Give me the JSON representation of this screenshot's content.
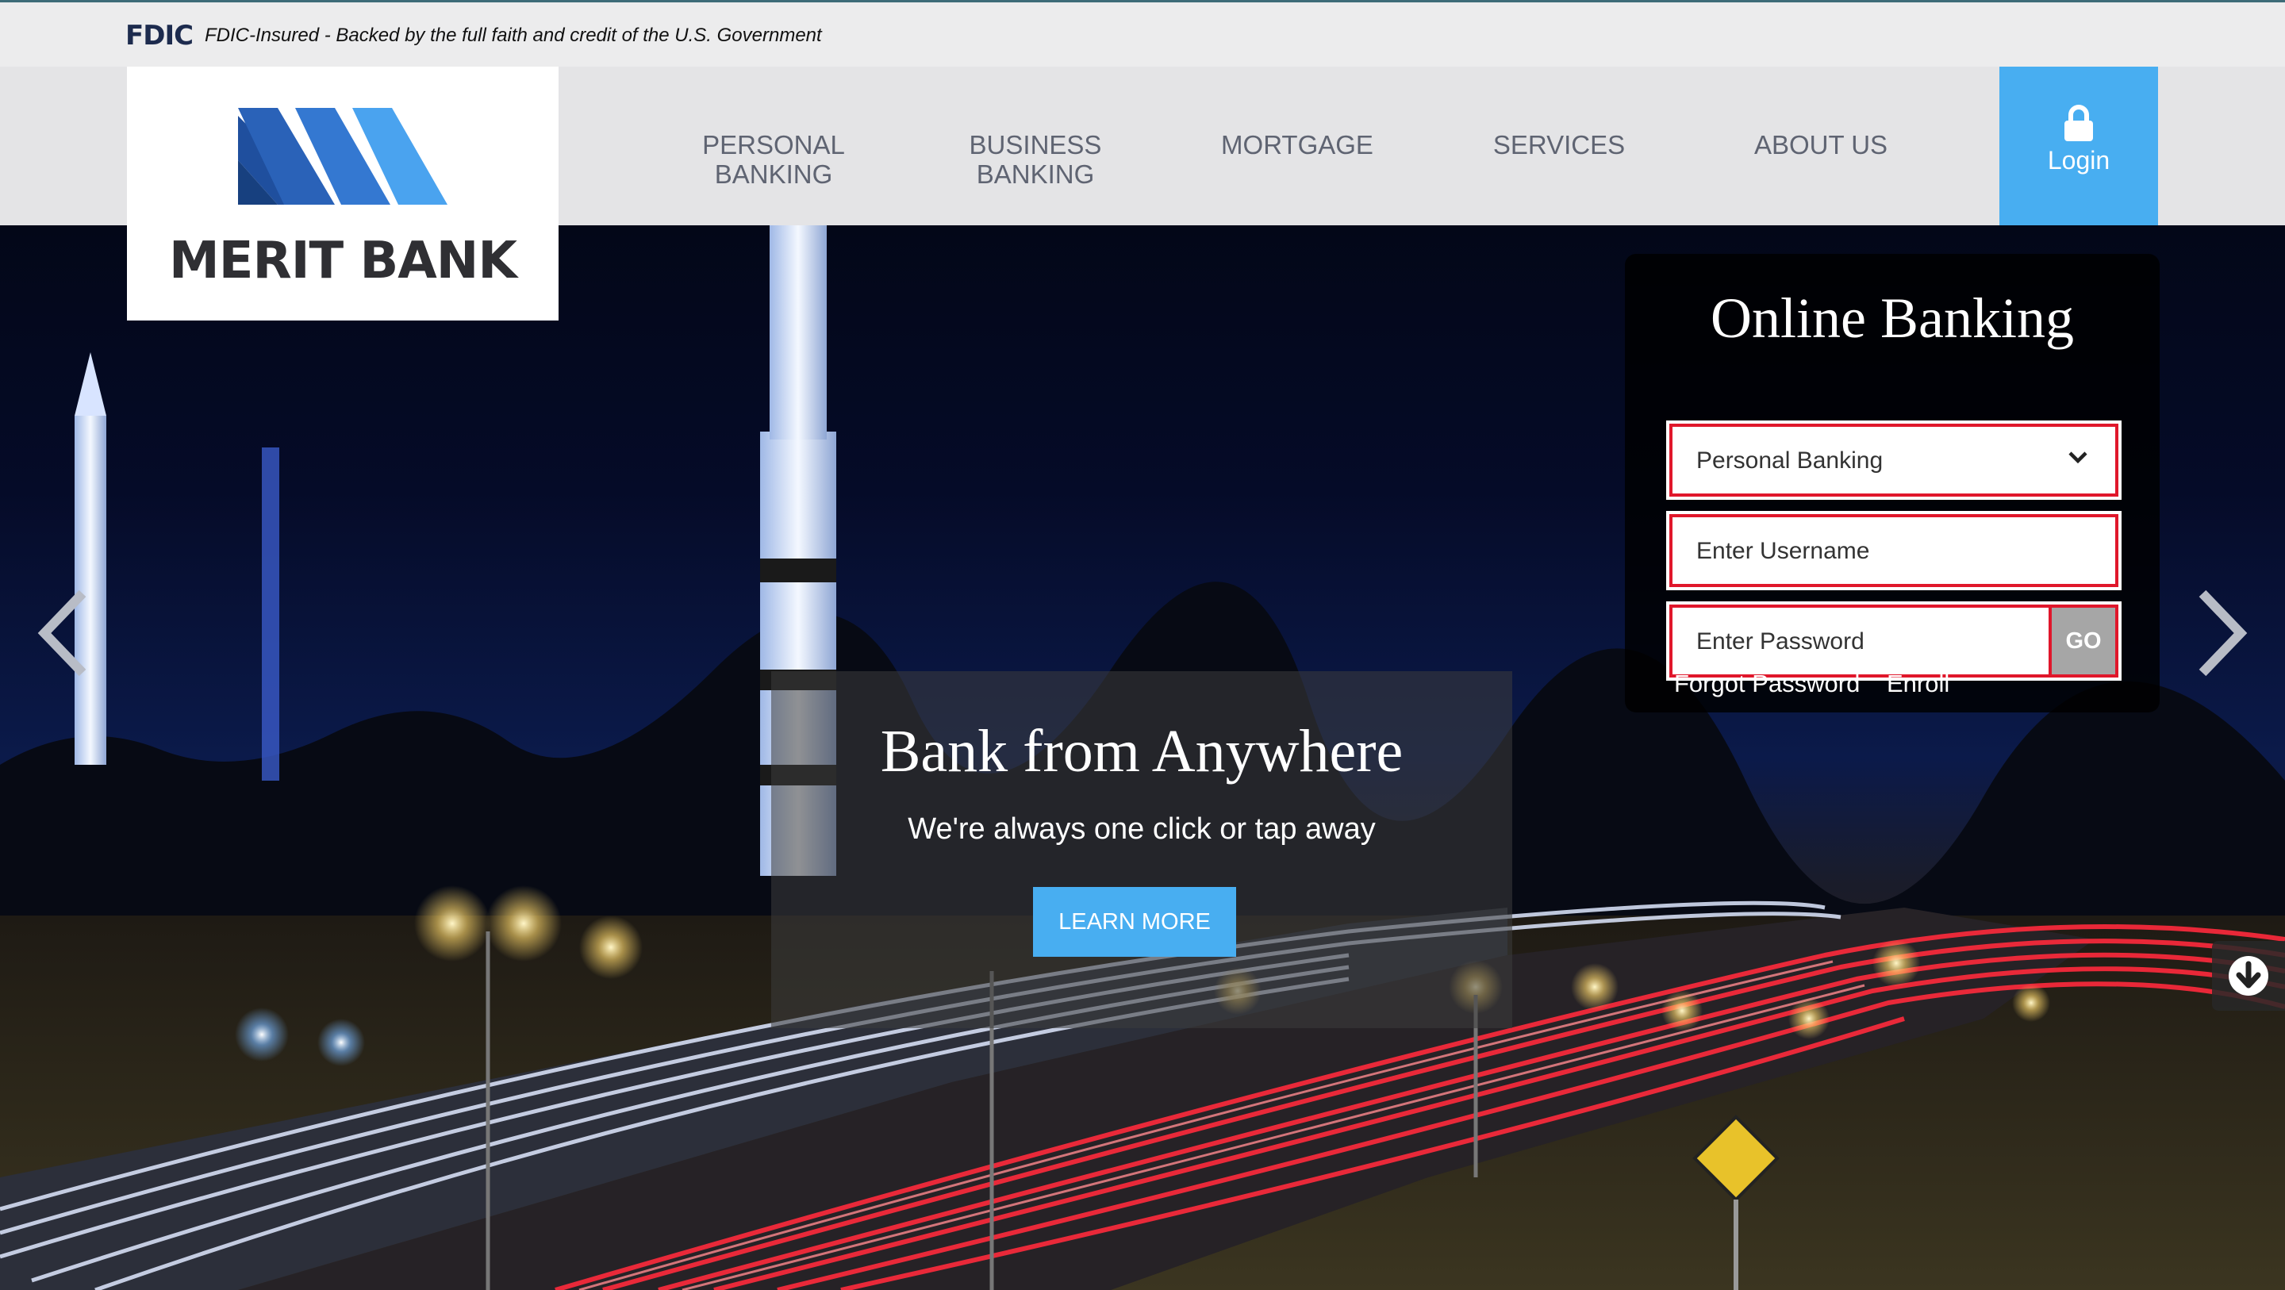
{
  "fdic": {
    "logo": "FDIC",
    "text": "FDIC-Insured - Backed by the full faith and credit of the U.S. Government"
  },
  "brand": {
    "name": "MERIT BANK",
    "colors": {
      "light": "#4aa3ef",
      "mid": "#3478d1",
      "dark": "#1f4f9e"
    }
  },
  "nav": {
    "items": [
      {
        "line1": "PERSONAL",
        "line2": "BANKING"
      },
      {
        "line1": "BUSINESS",
        "line2": "BANKING"
      },
      {
        "line1": "MORTGAGE",
        "line2": ""
      },
      {
        "line1": "SERVICES",
        "line2": ""
      },
      {
        "line1": "ABOUT US",
        "line2": ""
      }
    ],
    "login_label": "Login",
    "login_icon": "lock-icon"
  },
  "hero": {
    "title": "Bank from Anywhere",
    "subtitle": "We're always one click or tap away",
    "cta": "LEARN MORE",
    "prev_icon": "chevron-left-icon",
    "next_icon": "chevron-right-icon",
    "scroll_icon": "arrow-down-circle-icon"
  },
  "online_banking": {
    "title": "Online Banking",
    "account_type": "Personal Banking",
    "username_placeholder": "Enter Username",
    "password_placeholder": "Enter Password",
    "go_label": "GO",
    "forgot_password": "Forgot Password",
    "enroll": "Enroll",
    "accent_color": "#48aef1",
    "error_border_color": "#e0172b"
  }
}
